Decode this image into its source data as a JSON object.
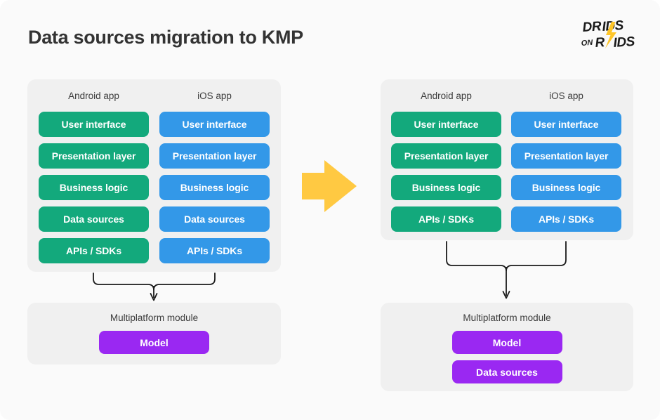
{
  "page": {
    "title": "Data sources migration to KMP",
    "background_color": "#fafafa"
  },
  "logo": {
    "name": "droids-on-roids-logo",
    "line1": "DROIDS",
    "line2_small": "ON",
    "line2": "ROIDS",
    "text_color": "#1a1a1a",
    "bolt_color": "#ffc629"
  },
  "colors": {
    "android": "#13a97c",
    "ios": "#3398e8",
    "shared": "#9a28f2",
    "panel": "#f0f0f0",
    "arrow": "#ffc942",
    "connector": "#1a1a1a",
    "title_text": "#333333",
    "label_text": "#3c3c3c"
  },
  "before": {
    "label": "before-migration",
    "stack": {
      "columns": [
        {
          "header": "Android app",
          "platform": "android",
          "layers": [
            "User interface",
            "Presentation layer",
            "Business logic",
            "Data sources",
            "APIs / SDKs"
          ]
        },
        {
          "header": "iOS app",
          "platform": "ios",
          "layers": [
            "User interface",
            "Presentation layer",
            "Business logic",
            "Data sources",
            "APIs / SDKs"
          ]
        }
      ]
    },
    "module": {
      "title": "Multiplatform module",
      "boxes": [
        "Model"
      ]
    }
  },
  "after": {
    "label": "after-migration",
    "stack": {
      "columns": [
        {
          "header": "Android app",
          "platform": "android",
          "layers": [
            "User interface",
            "Presentation layer",
            "Business logic",
            "APIs / SDKs"
          ]
        },
        {
          "header": "iOS app",
          "platform": "ios",
          "layers": [
            "User interface",
            "Presentation layer",
            "Business logic",
            "APIs / SDKs"
          ]
        }
      ]
    },
    "module": {
      "title": "Multiplatform module",
      "boxes": [
        "Model",
        "Data sources"
      ]
    }
  },
  "transition_arrow": {
    "name": "migration-arrow",
    "direction": "right",
    "color": "#ffc942"
  }
}
